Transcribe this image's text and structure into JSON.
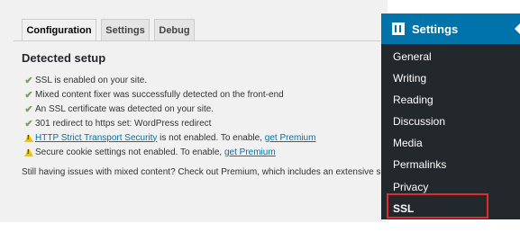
{
  "tabs": [
    {
      "label": "Configuration",
      "active": true
    },
    {
      "label": "Settings",
      "active": false
    },
    {
      "label": "Debug",
      "active": false
    }
  ],
  "heading": "Detected setup",
  "items": [
    {
      "icon": "check-icon",
      "text": "SSL is enabled on your site."
    },
    {
      "icon": "check-icon",
      "text": "Mixed content fixer was successfully detected on the front-end"
    },
    {
      "icon": "check-icon",
      "text": "An SSL certificate was detected on your site."
    },
    {
      "icon": "check-icon",
      "text": "301 redirect to https set: WordPress redirect"
    },
    {
      "icon": "warning-icon",
      "link_text": "HTTP Strict Transport Security",
      "text": " is not enabled. To enable, ",
      "link2": "get Premium"
    },
    {
      "icon": "warning-icon",
      "text": "Secure cookie settings not enabled. To enable, ",
      "link2": "get Premium"
    }
  ],
  "footer_note": "Still having issues with mixed content? Check out Premium, which includes an extensive scan and p",
  "sidebar": {
    "title": "Settings",
    "items": [
      "General",
      "Writing",
      "Reading",
      "Discussion",
      "Media",
      "Permalinks",
      "Privacy",
      "SSL"
    ],
    "current": "SSL"
  },
  "colors": {
    "sidebar_bg": "#23282d",
    "sidebar_header": "#0073aa",
    "highlight_box": "#e22a2a",
    "check": "#74a64a",
    "warning": "#f2c200",
    "link": "#0073aa"
  }
}
